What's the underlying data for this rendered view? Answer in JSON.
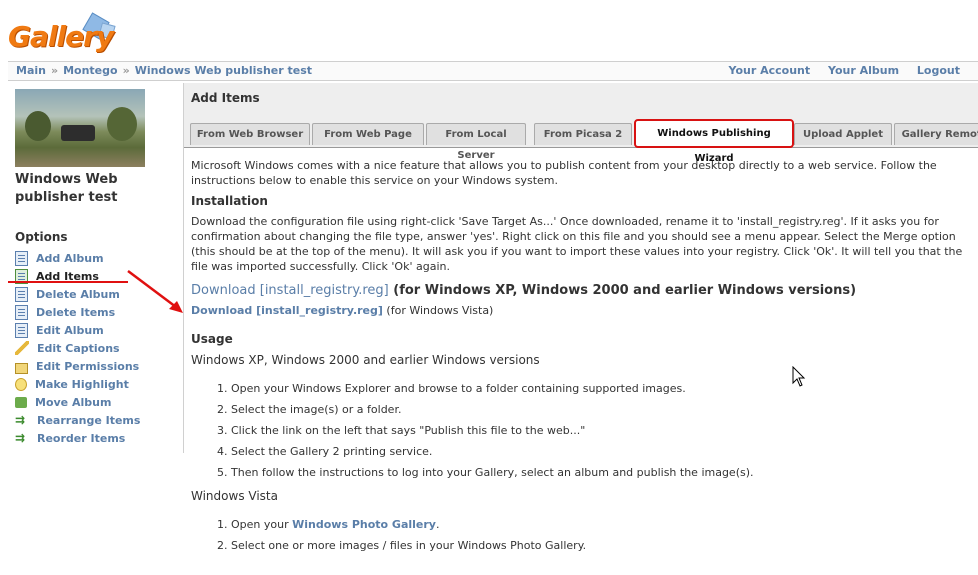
{
  "logo": {
    "text": "Gallery"
  },
  "breadcrumb": [
    "Main",
    "Montego",
    "Windows Web publisher test"
  ],
  "usernav": [
    "Your Account",
    "Your Album",
    "Logout"
  ],
  "sidebar": {
    "album_title": "Windows Web publisher test",
    "options_heading": "Options",
    "items": [
      {
        "label": "Add Album",
        "icon": "add-album-icon"
      },
      {
        "label": "Add Items",
        "icon": "add-items-icon"
      },
      {
        "label": "Delete Album",
        "icon": "delete-album-icon"
      },
      {
        "label": "Delete Items",
        "icon": "delete-items-icon"
      },
      {
        "label": "Edit Album",
        "icon": "edit-album-icon"
      },
      {
        "label": "Edit Captions",
        "icon": "pencil-icon"
      },
      {
        "label": "Edit Permissions",
        "icon": "lock-icon"
      },
      {
        "label": "Make Highlight",
        "icon": "bulb-icon"
      },
      {
        "label": "Move Album",
        "icon": "move-icon"
      },
      {
        "label": "Rearrange Items",
        "icon": "rearrange-icon"
      },
      {
        "label": "Reorder Items",
        "icon": "reorder-icon"
      }
    ]
  },
  "main": {
    "title": "Add Items",
    "tabs": [
      "From Web Browser",
      "From Web Page",
      "From Local Server",
      "From Picasa 2",
      "Windows Publishing Wizard",
      "Upload Applet",
      "Gallery Remote"
    ],
    "intro": "Microsoft Windows comes with a nice feature that allows you to publish content from your desktop directly to a web service. Follow the instructions below to enable this service on your Windows system.",
    "installation_heading": "Installation",
    "installation_text": "Download the configuration file using right-click 'Save Target As...' Once downloaded, rename it to 'install_registry.reg'. If it asks you for confirmation about changing the file type, answer 'yes'. Right click on this file and you should see a menu appear. Select the Merge option (this should be at the top of the menu). It will ask you if you want to import these values into your registry. Click 'Ok'. It will tell you that the file was imported successfully. Click 'Ok' again.",
    "download1_link": "Download [install_registry.reg]",
    "download1_suffix": " (for Windows XP, Windows 2000 and earlier Windows versions)",
    "download2_link": "Download [install_registry.reg]",
    "download2_suffix": " (for Windows Vista)",
    "usage_heading": "Usage",
    "xp_heading": "Windows XP, Windows 2000 and earlier Windows versions",
    "xp_steps": [
      "Open your Windows Explorer and browse to a folder containing supported images.",
      "Select the image(s) or a folder.",
      "Click the link on the left that says \"Publish this file to the web...\"",
      "Select the Gallery 2 printing service.",
      "Then follow the instructions to log into your Gallery, select an album and publish the image(s)."
    ],
    "vista_heading": "Windows Vista",
    "vista_step1_prefix": "Open your ",
    "vista_step1_link": "Windows Photo Gallery",
    "vista_step1_suffix": ".",
    "vista_step2": "Select one or more images / files in your Windows Photo Gallery."
  }
}
